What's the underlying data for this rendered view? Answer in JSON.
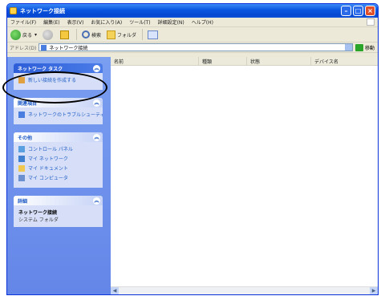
{
  "window": {
    "title": "ネットワーク接続"
  },
  "menubar": {
    "items": [
      "ファイル(F)",
      "編集(E)",
      "表示(V)",
      "お気に入り(A)",
      "ツール(T)",
      "詳細設定(N)",
      "ヘルプ(H)"
    ]
  },
  "toolbar": {
    "back_label": "戻る",
    "search_label": "検索",
    "folders_label": "フォルダ"
  },
  "address": {
    "label": "アドレス(D)",
    "value": "ネットワーク接続",
    "go_label": "移動"
  },
  "taskpane": {
    "network_tasks": {
      "title": "ネットワーク タスク",
      "items": [
        "新しい接続を作成する"
      ]
    },
    "see_also": {
      "title": "関連項目",
      "items": [
        "ネットワークのトラブルシューティング"
      ]
    },
    "other_places": {
      "title": "その他",
      "items": [
        "コントロール パネル",
        "マイ ネットワーク",
        "マイ ドキュメント",
        "マイ コンピュータ"
      ]
    },
    "details": {
      "title": "詳細",
      "name": "ネットワーク接続",
      "sub": "システム フォルダ"
    }
  },
  "listview": {
    "columns": [
      "名前",
      "種類",
      "状態",
      "デバイス名"
    ]
  },
  "colors": {
    "title_bar": "#0a55e0",
    "task_pane": "#6f95ee",
    "link": "#215dc6"
  }
}
